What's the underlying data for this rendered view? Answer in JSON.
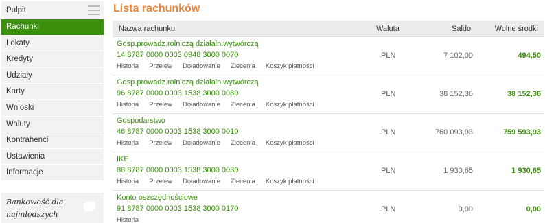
{
  "sidebar": {
    "items": [
      {
        "label": "Pulpit"
      },
      {
        "label": "Rachunki"
      },
      {
        "label": "Lokaty"
      },
      {
        "label": "Kredyty"
      },
      {
        "label": "Udziały"
      },
      {
        "label": "Karty"
      },
      {
        "label": "Wnioski"
      },
      {
        "label": "Waluty"
      },
      {
        "label": "Kontrahenci"
      },
      {
        "label": "Ustawienia"
      },
      {
        "label": "Informacje"
      }
    ],
    "active_color": "#3a8f0c",
    "promo": {
      "line1": "Bankowość dla",
      "line2": "najmłodszych"
    }
  },
  "main": {
    "title": "Lista rachunków",
    "columns": {
      "name": "Nazwa rachunku",
      "currency": "Waluta",
      "balance": "Saldo",
      "available": "Wolne środki"
    },
    "accounts": [
      {
        "name": "Gosp.prowadz.rolniczą działaln.wytwórczą",
        "number": "14 8787 0000 0003 0948 3000 0070",
        "currency": "PLN",
        "balance": "7 102,00",
        "available": "494,50",
        "actions": [
          "Historia",
          "Przelew",
          "Doładowanie",
          "Zlecenia",
          "Koszyk płatności"
        ]
      },
      {
        "name": "Gosp.prowadz.rolniczą działaln.wytwórczą",
        "number": "96 8787 0000 0003 1538 3000 0080",
        "currency": "PLN",
        "balance": "38 152,36",
        "available": "38 152,36",
        "actions": [
          "Historia",
          "Przelew",
          "Doładowanie",
          "Zlecenia",
          "Koszyk płatności"
        ]
      },
      {
        "name": "Gospodarstwo",
        "number": "46 8787 0000 0003 1538 3000 0010",
        "currency": "PLN",
        "balance": "760 093,93",
        "available": "759 593,93",
        "actions": [
          "Historia",
          "Przelew",
          "Doładowanie",
          "Zlecenia",
          "Koszyk płatności"
        ]
      },
      {
        "name": "IKE",
        "number": "88 8787 0000 0003 1538 3000 0030",
        "currency": "PLN",
        "balance": "1 930,65",
        "available": "1 930,65",
        "actions": [
          "Historia",
          "Przelew",
          "Doładowanie",
          "Zlecenia",
          "Koszyk płatności"
        ]
      },
      {
        "name": "Konto oszczędnościowe",
        "number": "91 8787 0000 0003 1538 3000 0170",
        "currency": "PLN",
        "balance": "0,00",
        "available": "0,00",
        "actions": [
          "Historia"
        ]
      }
    ],
    "title_color": "#e6863a",
    "link_color": "#3a8f0c"
  }
}
